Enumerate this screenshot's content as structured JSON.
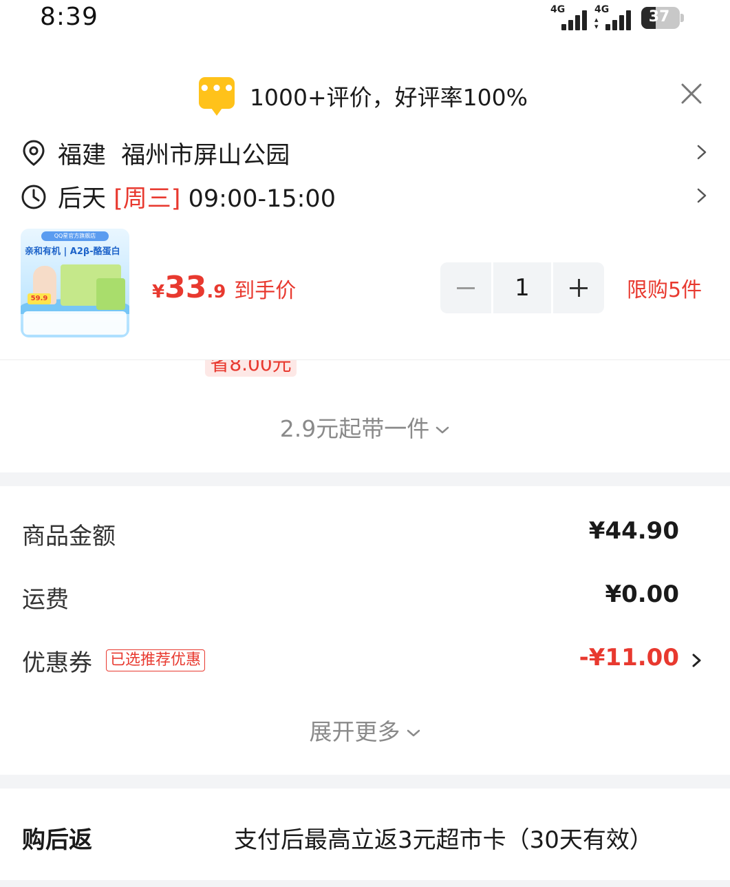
{
  "status_bar": {
    "time": "8:39",
    "signal_1_label": "4G",
    "signal_2_label": "4G",
    "battery_level": "37"
  },
  "review_banner": {
    "icon": "chat-bubble-icon",
    "text": "1000+评价，好评率100%"
  },
  "address": {
    "icon": "location-pin-icon",
    "province": "福建",
    "detail": "福州市屏山公园"
  },
  "delivery": {
    "icon": "clock-icon",
    "day": "后天",
    "weekday": "[周三]",
    "time_range": "09:00-15:00"
  },
  "product": {
    "thumbnail": {
      "banner": "QQ星官方旗舰店",
      "title": "亲和有机 | A2β-酪蛋白",
      "price_tag": "59.9"
    },
    "price_currency": "¥",
    "price_integer": "33",
    "price_decimal": ".9",
    "price_label": "到手价",
    "quantity": "1",
    "limit_text": "限购5件",
    "savings_text": "省8.00元"
  },
  "addon_text": "2.9元起带一件",
  "fees": {
    "goods_label": "商品金额",
    "goods_value": "¥44.90",
    "shipping_label": "运费",
    "shipping_value": "¥0.00",
    "coupon_label": "优惠券",
    "coupon_badge": "已选推荐优惠",
    "coupon_value": "-¥11.00"
  },
  "expand_text": "展开更多",
  "cashback": {
    "label": "购后返",
    "text": "支付后最高立返3元超市卡（30天有效）"
  },
  "colors": {
    "accent_red": "#e8392f",
    "review_yellow": "#ffc21a",
    "divider_gray": "#f3f4f6"
  }
}
